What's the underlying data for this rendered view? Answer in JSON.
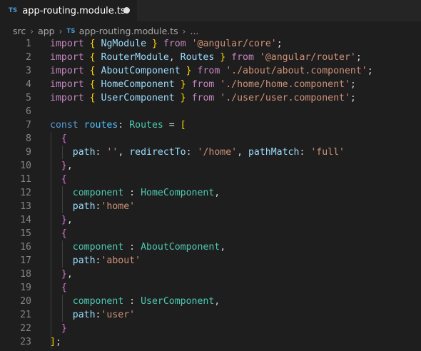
{
  "tab": {
    "icon": "TS",
    "title": "app-routing.module.ts"
  },
  "breadcrumb": {
    "items": [
      "src",
      "app"
    ],
    "file_icon": "TS",
    "file": "app-routing.module.ts",
    "more": "..."
  },
  "lines": [
    {
      "n": "1",
      "tokens": [
        [
          "kw",
          "import"
        ],
        [
          "pl",
          " "
        ],
        [
          "b1",
          "{"
        ],
        [
          "pl",
          " "
        ],
        [
          "prop",
          "NgModule"
        ],
        [
          "pl",
          " "
        ],
        [
          "b1",
          "}"
        ],
        [
          "pl",
          " "
        ],
        [
          "kw",
          "from"
        ],
        [
          "pl",
          " "
        ],
        [
          "str",
          "'@angular/core'"
        ],
        [
          "pl",
          ";"
        ]
      ]
    },
    {
      "n": "2",
      "tokens": [
        [
          "kw",
          "import"
        ],
        [
          "pl",
          " "
        ],
        [
          "b1",
          "{"
        ],
        [
          "pl",
          " "
        ],
        [
          "prop",
          "RouterModule"
        ],
        [
          "pl",
          ", "
        ],
        [
          "prop",
          "Routes"
        ],
        [
          "pl",
          " "
        ],
        [
          "b1",
          "}"
        ],
        [
          "pl",
          " "
        ],
        [
          "kw",
          "from"
        ],
        [
          "pl",
          " "
        ],
        [
          "str",
          "'@angular/router'"
        ],
        [
          "pl",
          ";"
        ]
      ]
    },
    {
      "n": "3",
      "tokens": [
        [
          "kw",
          "import"
        ],
        [
          "pl",
          " "
        ],
        [
          "b1",
          "{"
        ],
        [
          "pl",
          " "
        ],
        [
          "prop",
          "AboutComponent"
        ],
        [
          "pl",
          " "
        ],
        [
          "b1",
          "}"
        ],
        [
          "pl",
          " "
        ],
        [
          "kw",
          "from"
        ],
        [
          "pl",
          " "
        ],
        [
          "str",
          "'./about/about.component'"
        ],
        [
          "pl",
          ";"
        ]
      ]
    },
    {
      "n": "4",
      "tokens": [
        [
          "kw",
          "import"
        ],
        [
          "pl",
          " "
        ],
        [
          "b1",
          "{"
        ],
        [
          "pl",
          " "
        ],
        [
          "prop",
          "HomeComponent"
        ],
        [
          "pl",
          " "
        ],
        [
          "b1",
          "}"
        ],
        [
          "pl",
          " "
        ],
        [
          "kw",
          "from"
        ],
        [
          "pl",
          " "
        ],
        [
          "str",
          "'./home/home.component'"
        ],
        [
          "pl",
          ";"
        ]
      ]
    },
    {
      "n": "5",
      "tokens": [
        [
          "kw",
          "import"
        ],
        [
          "pl",
          " "
        ],
        [
          "b1",
          "{"
        ],
        [
          "pl",
          " "
        ],
        [
          "prop",
          "UserComponent"
        ],
        [
          "pl",
          " "
        ],
        [
          "b1",
          "}"
        ],
        [
          "pl",
          " "
        ],
        [
          "kw",
          "from"
        ],
        [
          "pl",
          " "
        ],
        [
          "str",
          "'./user/user.component'"
        ],
        [
          "pl",
          ";"
        ]
      ]
    },
    {
      "n": "6",
      "tokens": []
    },
    {
      "n": "7",
      "tokens": [
        [
          "kw2",
          "const"
        ],
        [
          "pl",
          " "
        ],
        [
          "var",
          "routes"
        ],
        [
          "pl",
          ": "
        ],
        [
          "cls",
          "Routes"
        ],
        [
          "pl",
          " = "
        ],
        [
          "b1",
          "["
        ]
      ]
    },
    {
      "n": "8",
      "tokens": [
        [
          "pl",
          "  "
        ],
        [
          "b2",
          "{"
        ]
      ]
    },
    {
      "n": "9",
      "tokens": [
        [
          "pl",
          "    "
        ],
        [
          "prop",
          "path"
        ],
        [
          "pl",
          ": "
        ],
        [
          "str",
          "''"
        ],
        [
          "pl",
          ", "
        ],
        [
          "prop",
          "redirectTo"
        ],
        [
          "pl",
          ": "
        ],
        [
          "str",
          "'/home'"
        ],
        [
          "pl",
          ", "
        ],
        [
          "prop",
          "pathMatch"
        ],
        [
          "pl",
          ": "
        ],
        [
          "str",
          "'full'"
        ]
      ]
    },
    {
      "n": "10",
      "tokens": [
        [
          "pl",
          "  "
        ],
        [
          "b2",
          "}"
        ],
        [
          "pl",
          ","
        ]
      ]
    },
    {
      "n": "11",
      "tokens": [
        [
          "pl",
          "  "
        ],
        [
          "b2",
          "{"
        ]
      ]
    },
    {
      "n": "12",
      "tokens": [
        [
          "pl",
          "    "
        ],
        [
          "cls",
          "component"
        ],
        [
          "pl",
          " : "
        ],
        [
          "cls",
          "HomeComponent"
        ],
        [
          "pl",
          ","
        ]
      ]
    },
    {
      "n": "13",
      "tokens": [
        [
          "pl",
          "    "
        ],
        [
          "prop",
          "path"
        ],
        [
          "pl",
          ":"
        ],
        [
          "str",
          "'home'"
        ]
      ]
    },
    {
      "n": "14",
      "tokens": [
        [
          "pl",
          "  "
        ],
        [
          "b2",
          "}"
        ],
        [
          "pl",
          ","
        ]
      ]
    },
    {
      "n": "15",
      "tokens": [
        [
          "pl",
          "  "
        ],
        [
          "b2",
          "{"
        ]
      ]
    },
    {
      "n": "16",
      "tokens": [
        [
          "pl",
          "    "
        ],
        [
          "cls",
          "component"
        ],
        [
          "pl",
          " : "
        ],
        [
          "cls",
          "AboutComponent"
        ],
        [
          "pl",
          ","
        ]
      ]
    },
    {
      "n": "17",
      "tokens": [
        [
          "pl",
          "    "
        ],
        [
          "prop",
          "path"
        ],
        [
          "pl",
          ":"
        ],
        [
          "str",
          "'about'"
        ]
      ]
    },
    {
      "n": "18",
      "tokens": [
        [
          "pl",
          "  "
        ],
        [
          "b2",
          "}"
        ],
        [
          "pl",
          ","
        ]
      ]
    },
    {
      "n": "19",
      "tokens": [
        [
          "pl",
          "  "
        ],
        [
          "b2",
          "{"
        ]
      ]
    },
    {
      "n": "20",
      "tokens": [
        [
          "pl",
          "    "
        ],
        [
          "cls",
          "component"
        ],
        [
          "pl",
          " : "
        ],
        [
          "cls",
          "UserComponent"
        ],
        [
          "pl",
          ","
        ]
      ]
    },
    {
      "n": "21",
      "tokens": [
        [
          "pl",
          "    "
        ],
        [
          "prop",
          "path"
        ],
        [
          "pl",
          ":"
        ],
        [
          "str",
          "'user'"
        ]
      ]
    },
    {
      "n": "22",
      "tokens": [
        [
          "pl",
          "  "
        ],
        [
          "b2",
          "}"
        ]
      ]
    },
    {
      "n": "23",
      "tokens": [
        [
          "b1",
          "]"
        ],
        [
          "pl",
          ";"
        ]
      ]
    }
  ]
}
